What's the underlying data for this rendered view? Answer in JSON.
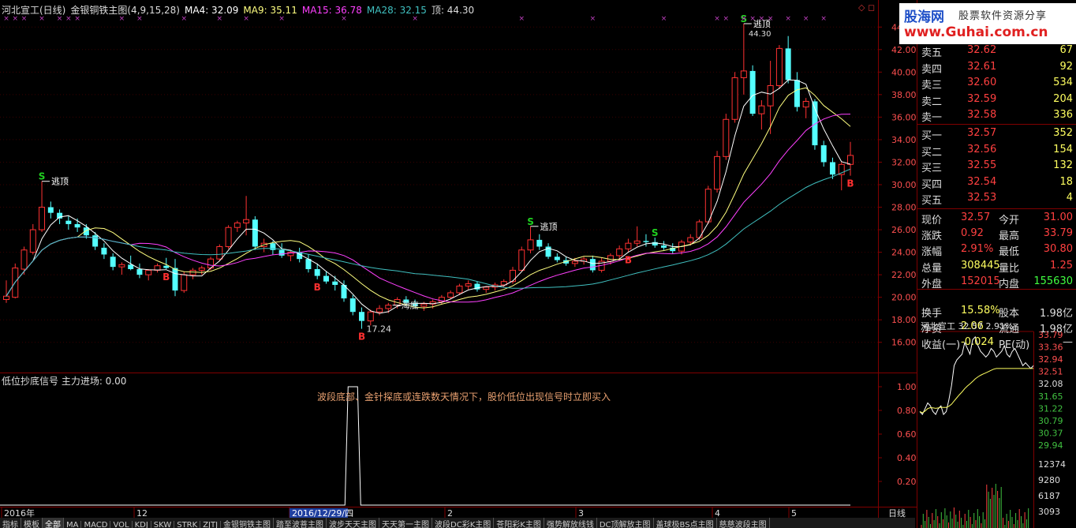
{
  "chart_title": {
    "name": "河北宣工(日线)",
    "formula": "金银铜铁主图(4,9,15,28)",
    "ma4": "MA4: 32.09",
    "ma9": "MA9: 35.11",
    "ma15": "MA15: 36.78",
    "ma28": "MA28: 32.15",
    "top": "顶: 44.30"
  },
  "colors": {
    "up": "#ff3232",
    "down": "#54ffff",
    "ma4": "#ffffff",
    "ma9": "#ffff80",
    "ma15": "#ff40ff",
    "ma28": "#40c0c0",
    "grid": "#800000",
    "axis_text": "#ff5050"
  },
  "indicator": {
    "title": "低位抄底信号  主力进场: 0.00",
    "note": "波段底部、金针探底或连跌数天情况下，股价低位出现信号时立即买入",
    "y_ticks": [
      "1.00",
      "0.80",
      "0.60",
      "0.40",
      "0.20"
    ]
  },
  "annotations": {
    "escape_top": "逃顶",
    "bottom": "海底",
    "low_price": "17.24",
    "high_price": "44.30",
    "buy": "B",
    "sell": "S"
  },
  "x_axis": {
    "labels": [
      "2016年",
      "12",
      "2016/12/29/四",
      "2",
      "3",
      "4",
      "5"
    ],
    "right_label": "日线"
  },
  "watermark": {
    "logo": "股海网",
    "slogan": "股票软件资源分享",
    "url": "www.Guhai.com.cn"
  },
  "quotes": {
    "asks": [
      {
        "label": "卖五",
        "price": "32.62",
        "vol": "67"
      },
      {
        "label": "卖四",
        "price": "32.61",
        "vol": "92"
      },
      {
        "label": "卖三",
        "price": "32.60",
        "vol": "534"
      },
      {
        "label": "卖二",
        "price": "32.59",
        "vol": "204"
      },
      {
        "label": "卖一",
        "price": "32.58",
        "vol": "336"
      }
    ],
    "bids": [
      {
        "label": "买一",
        "price": "32.57",
        "vol": "352"
      },
      {
        "label": "买二",
        "price": "32.56",
        "vol": "154"
      },
      {
        "label": "买三",
        "price": "32.55",
        "vol": "132"
      },
      {
        "label": "买四",
        "price": "32.54",
        "vol": "18"
      },
      {
        "label": "买五",
        "price": "32.53",
        "vol": "4"
      }
    ],
    "stats": [
      {
        "l1": "现价",
        "v1": "32.57",
        "l2": "今开",
        "v2": "31.00"
      },
      {
        "l1": "涨跌",
        "v1": "0.92",
        "l2": "最高",
        "v2": "33.79"
      },
      {
        "l1": "涨幅",
        "v1": "2.91%",
        "l2": "最低",
        "v2": "30.80"
      },
      {
        "l1": "总量",
        "v1": "308445",
        "l2": "量比",
        "v2": "1.25"
      },
      {
        "l1": "外盘",
        "v1": "152015",
        "l2": "内盘",
        "v2": "155630"
      },
      {
        "l1": "换手",
        "v1": "15.58%",
        "l2": "股本",
        "v2": "1.98亿"
      },
      {
        "l1": "净资",
        "v1": "2.06",
        "l2": "流通",
        "v2": "1.98亿"
      },
      {
        "l1": "收益(一)",
        "v1": "-0.024",
        "l2": "PE(动)",
        "v2": "—"
      }
    ]
  },
  "mini_chart": {
    "title": "河北宣工  32.57  2.91%",
    "price_ticks": [
      "33.79",
      "33.36",
      "32.94",
      "32.51",
      "32.08",
      "31.65",
      "31.22",
      "30.79",
      "30.37",
      "29.94"
    ],
    "vol_ticks": [
      "12374",
      "9280",
      "6187",
      "3093"
    ]
  },
  "tabs": [
    "指标",
    "模板",
    "全部",
    "MA",
    "MACD",
    "VOL",
    "KDJ",
    "SKW",
    "STRK",
    "ZJTJ",
    "金银铜铁主图",
    "踏至波菩主图",
    "波步天天主图",
    "天天第一主图",
    "波段DC彩K主图",
    "苍阳彩K主图",
    "强势解放线钱",
    "DC顶解放主图",
    "盖球极BS点主图",
    "慈慈波段主图"
  ],
  "active_tab": "全部",
  "chart_data": {
    "type": "candlestick",
    "title": "河北宣工(日线)",
    "y_axis": [
      "44.00",
      "42.00",
      "40.00",
      "38.00",
      "36.00",
      "34.00",
      "32.00",
      "30.00",
      "28.00",
      "26.00",
      "24.00",
      "22.00",
      "20.00",
      "18.00",
      "16.00"
    ],
    "ylim": [
      15,
      45
    ],
    "candles": [
      [
        19.8,
        21.5,
        19.5,
        20.1
      ],
      [
        20.0,
        23.0,
        19.9,
        22.6
      ],
      [
        22.5,
        24.5,
        22.0,
        24.2
      ],
      [
        24.0,
        26.5,
        23.8,
        26.0
      ],
      [
        26.0,
        30.3,
        25.8,
        28.0
      ],
      [
        28.0,
        28.5,
        27.0,
        27.5
      ],
      [
        27.5,
        27.8,
        26.5,
        27.0
      ],
      [
        26.8,
        27.2,
        26.0,
        26.5
      ],
      [
        26.5,
        27.0,
        25.8,
        26.2
      ],
      [
        26.2,
        26.5,
        25.2,
        25.5
      ],
      [
        25.5,
        25.8,
        24.2,
        24.5
      ],
      [
        24.4,
        24.8,
        23.4,
        23.8
      ],
      [
        23.6,
        23.9,
        22.4,
        22.7
      ],
      [
        22.7,
        23.1,
        22.0,
        22.9
      ],
      [
        22.9,
        23.7,
        22.4,
        22.5
      ],
      [
        22.5,
        23.0,
        21.7,
        22.0
      ],
      [
        22.0,
        22.5,
        21.5,
        22.4
      ],
      [
        22.4,
        23.0,
        22.2,
        22.8
      ],
      [
        22.8,
        23.5,
        22.5,
        22.6
      ],
      [
        22.6,
        23.4,
        20.1,
        20.6
      ],
      [
        20.6,
        22.3,
        20.4,
        22.0
      ],
      [
        22.0,
        22.6,
        21.6,
        22.4
      ],
      [
        22.4,
        22.8,
        22.0,
        22.6
      ],
      [
        22.6,
        23.6,
        22.4,
        23.4
      ],
      [
        23.4,
        24.7,
        23.2,
        24.5
      ],
      [
        24.5,
        26.4,
        24.3,
        26.2
      ],
      [
        26.2,
        26.8,
        25.8,
        26.6
      ],
      [
        26.6,
        29.0,
        25.5,
        26.9
      ],
      [
        26.9,
        27.2,
        24.2,
        24.5
      ],
      [
        24.5,
        25.2,
        24.0,
        24.8
      ],
      [
        24.8,
        25.0,
        23.8,
        24.2
      ],
      [
        24.2,
        24.8,
        23.5,
        23.7
      ],
      [
        23.7,
        24.2,
        23.2,
        24.0
      ],
      [
        24.0,
        24.4,
        23.1,
        23.4
      ],
      [
        23.4,
        23.8,
        22.2,
        22.5
      ],
      [
        22.5,
        23.0,
        21.6,
        21.9
      ],
      [
        21.9,
        22.3,
        21.2,
        21.4
      ],
      [
        21.4,
        21.9,
        20.6,
        21.1
      ],
      [
        21.1,
        21.5,
        19.6,
        19.9
      ],
      [
        19.9,
        20.2,
        18.4,
        18.7
      ],
      [
        18.7,
        19.1,
        17.2,
        17.9
      ],
      [
        17.9,
        18.9,
        17.5,
        18.7
      ],
      [
        18.7,
        19.3,
        18.4,
        19.0
      ],
      [
        19.0,
        19.5,
        18.6,
        19.3
      ],
      [
        19.3,
        20.0,
        19.0,
        19.8
      ],
      [
        19.8,
        20.1,
        19.2,
        19.5
      ],
      [
        19.5,
        19.8,
        19.0,
        19.2
      ],
      [
        19.2,
        19.6,
        18.8,
        19.4
      ],
      [
        19.4,
        19.8,
        19.0,
        19.6
      ],
      [
        19.6,
        20.2,
        19.4,
        20.0
      ],
      [
        20.0,
        20.6,
        19.8,
        20.4
      ],
      [
        20.4,
        21.2,
        20.2,
        21.0
      ],
      [
        21.0,
        21.5,
        20.7,
        21.2
      ],
      [
        21.2,
        21.4,
        20.5,
        20.7
      ],
      [
        20.7,
        21.0,
        20.4,
        20.9
      ],
      [
        20.9,
        21.3,
        20.6,
        21.1
      ],
      [
        21.1,
        21.6,
        20.9,
        21.4
      ],
      [
        21.4,
        22.7,
        21.2,
        22.4
      ],
      [
        22.4,
        24.5,
        22.3,
        24.2
      ],
      [
        24.2,
        26.3,
        23.9,
        25.1
      ],
      [
        25.1,
        25.6,
        24.2,
        24.5
      ],
      [
        24.5,
        24.8,
        23.4,
        23.6
      ],
      [
        23.6,
        23.9,
        23.1,
        23.3
      ],
      [
        23.3,
        23.6,
        22.8,
        23.0
      ],
      [
        23.0,
        23.5,
        22.7,
        23.2
      ],
      [
        23.2,
        23.6,
        22.9,
        23.4
      ],
      [
        23.4,
        23.7,
        22.2,
        22.4
      ],
      [
        22.4,
        23.5,
        22.2,
        23.2
      ],
      [
        23.2,
        23.9,
        22.9,
        23.7
      ],
      [
        23.7,
        24.6,
        23.4,
        24.3
      ],
      [
        24.3,
        25.2,
        24.0,
        24.8
      ],
      [
        24.8,
        26.3,
        24.5,
        25.0
      ],
      [
        25.0,
        25.6,
        24.5,
        24.9
      ],
      [
        24.9,
        25.3,
        24.4,
        24.6
      ],
      [
        24.6,
        25.0,
        24.2,
        24.4
      ],
      [
        24.4,
        24.8,
        23.9,
        24.1
      ],
      [
        24.1,
        25.1,
        23.8,
        24.9
      ],
      [
        24.9,
        25.6,
        24.6,
        25.3
      ],
      [
        25.3,
        26.9,
        25.1,
        26.7
      ],
      [
        26.7,
        29.9,
        26.5,
        29.6
      ],
      [
        29.6,
        33.0,
        29.3,
        32.5
      ],
      [
        32.5,
        36.3,
        32.2,
        35.8
      ],
      [
        35.8,
        40.0,
        35.5,
        39.5
      ],
      [
        39.5,
        44.3,
        38.0,
        40.1
      ],
      [
        40.1,
        40.6,
        36.1,
        36.3
      ],
      [
        36.3,
        37.5,
        34.9,
        37.0
      ],
      [
        37.0,
        41.0,
        34.5,
        38.8
      ],
      [
        38.8,
        42.4,
        38.5,
        42.1
      ],
      [
        42.1,
        43.2,
        39.0,
        39.3
      ],
      [
        39.3,
        40.0,
        36.5,
        36.9
      ],
      [
        36.9,
        37.7,
        35.9,
        37.4
      ],
      [
        37.4,
        37.6,
        33.1,
        33.5
      ],
      [
        33.5,
        33.9,
        31.6,
        32.0
      ],
      [
        32.0,
        32.4,
        30.5,
        30.9
      ],
      [
        30.9,
        32.0,
        29.5,
        31.8
      ],
      [
        31.8,
        33.8,
        30.8,
        32.6
      ]
    ],
    "ma_series": [
      "MA4",
      "MA9",
      "MA15",
      "MA28"
    ],
    "signals": [
      {
        "i": 4,
        "type": "S",
        "text": "逃顶",
        "price": 30.3
      },
      {
        "i": 18,
        "type": "B"
      },
      {
        "i": 35,
        "type": "B"
      },
      {
        "i": 40,
        "type": "B",
        "text": "17.24",
        "price": 17.2
      },
      {
        "i": 44,
        "type": "low",
        "text": "海底",
        "price": 19.3
      },
      {
        "i": 59,
        "type": "S",
        "text": "逃顶",
        "price": 26.3
      },
      {
        "i": 70,
        "type": "B"
      },
      {
        "i": 73,
        "type": "S"
      },
      {
        "i": 83,
        "type": "S",
        "text": "逃顶",
        "price": 44.3
      },
      {
        "i": 95,
        "type": "B"
      }
    ],
    "indicator_spike": {
      "i": 39,
      "value": 1.0
    }
  }
}
